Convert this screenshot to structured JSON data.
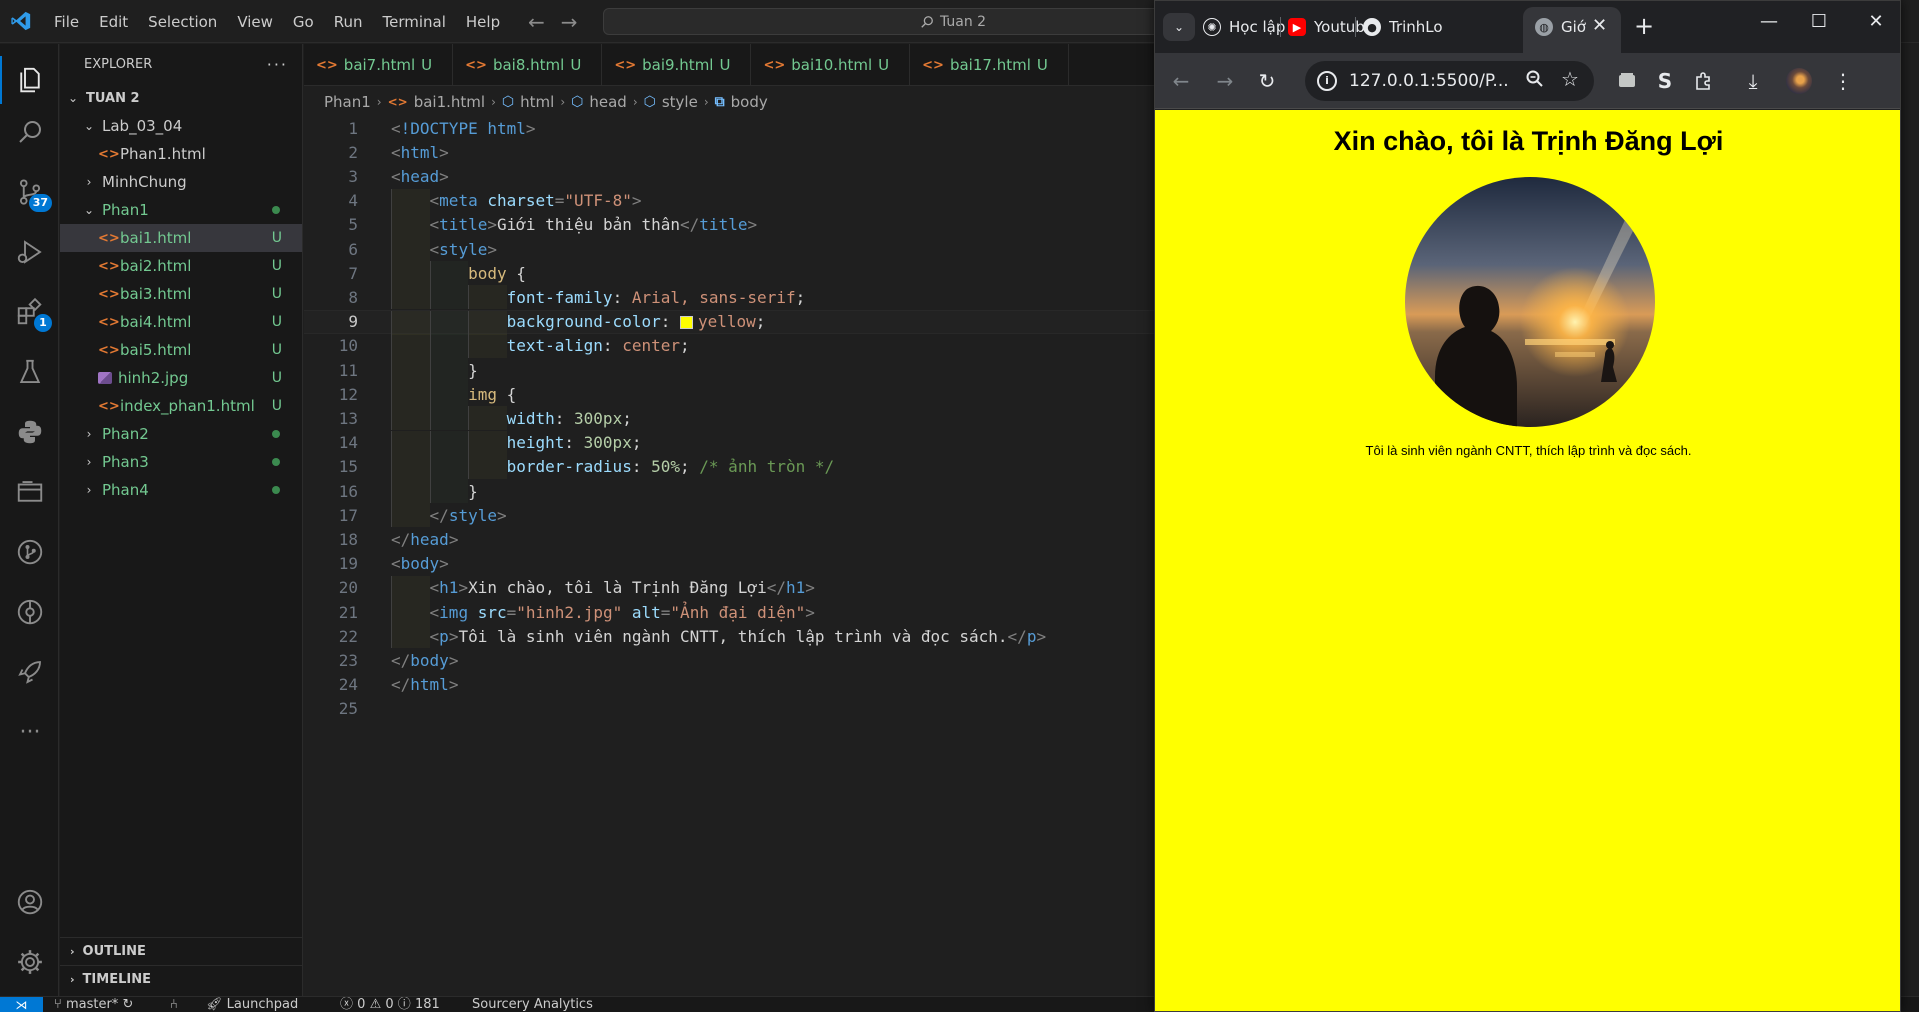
{
  "vscode": {
    "menu": [
      "File",
      "Edit",
      "Selection",
      "View",
      "Go",
      "Run",
      "Terminal",
      "Help"
    ],
    "command_center": "Tuan 2",
    "activity_badges": {
      "source_control": "37",
      "extensions": "1"
    },
    "explorer": {
      "title": "EXPLORER",
      "root": "TUAN 2",
      "items": [
        {
          "label": "Lab_03_04",
          "type": "folder-open",
          "indent": 1
        },
        {
          "label": "Phan1.html",
          "type": "html",
          "indent": 2
        },
        {
          "label": "MinhChung",
          "type": "folder",
          "indent": 1
        },
        {
          "label": "Phan1",
          "type": "folder-open",
          "indent": 1,
          "git": "dot"
        },
        {
          "label": "bai1.html",
          "type": "html",
          "indent": 2,
          "git": "U",
          "selected": true
        },
        {
          "label": "bai2.html",
          "type": "html",
          "indent": 2,
          "git": "U"
        },
        {
          "label": "bai3.html",
          "type": "html",
          "indent": 2,
          "git": "U"
        },
        {
          "label": "bai4.html",
          "type": "html",
          "indent": 2,
          "git": "U"
        },
        {
          "label": "bai5.html",
          "type": "html",
          "indent": 2,
          "git": "U"
        },
        {
          "label": "hinh2.jpg",
          "type": "image",
          "indent": 2,
          "git": "U"
        },
        {
          "label": "index_phan1.html",
          "type": "html",
          "indent": 2,
          "git": "U"
        },
        {
          "label": "Phan2",
          "type": "folder",
          "indent": 1,
          "git": "dot"
        },
        {
          "label": "Phan3",
          "type": "folder",
          "indent": 1,
          "git": "dot"
        },
        {
          "label": "Phan4",
          "type": "folder",
          "indent": 1,
          "git": "dot"
        }
      ],
      "outline": "OUTLINE",
      "timeline": "TIMELINE"
    },
    "tabs": [
      {
        "label": "bai7.html",
        "status": "U"
      },
      {
        "label": "bai8.html",
        "status": "U"
      },
      {
        "label": "bai9.html",
        "status": "U"
      },
      {
        "label": "bai10.html",
        "status": "U"
      },
      {
        "label": "bai17.html",
        "status": "U"
      }
    ],
    "breadcrumb": [
      "Phan1",
      "bai1.html",
      "html",
      "head",
      "style",
      "body"
    ],
    "current_line": 9,
    "code_lines": [
      "<!DOCTYPE html>",
      "<html>",
      "<head>",
      "    <meta charset=\"UTF-8\">",
      "    <title>Giới thiệu bản thân</title>",
      "    <style>",
      "        body {",
      "            font-family: Arial, sans-serif;",
      "            background-color: yellow;",
      "            text-align: center;",
      "        }",
      "        img {",
      "            width: 300px;",
      "            height: 300px;",
      "            border-radius: 50%; /* ảnh tròn */",
      "        }",
      "    </style>",
      "</head>",
      "<body>",
      "    <h1>Xin chào, tôi là Trịnh Đăng Lợi</h1>",
      "    <img src=\"hinh2.jpg\" alt=\"Ảnh đại diện\">",
      "    <p>Tôi là sinh viên ngành CNTT, thích lập trình và đọc sách.</p>",
      "</body>",
      "</html>",
      ""
    ],
    "status": {
      "branch": "master*",
      "launchpad": "Launchpad",
      "errors": "0",
      "warnings": "0",
      "info": "181",
      "analytics": "Sourcery Analytics"
    }
  },
  "browser": {
    "tabs": [
      {
        "label": "Học lập",
        "favicon": "chatgpt-icon"
      },
      {
        "label": "Youtub",
        "favicon": "youtube-icon"
      },
      {
        "label": "TrinhLo",
        "favicon": "github-icon"
      },
      {
        "label": "Giớ",
        "favicon": "globe-icon",
        "active": true
      }
    ],
    "url": "127.0.0.1:5500/P...",
    "page": {
      "heading": "Xin chào, tôi là Trịnh Đăng Lợi",
      "image_alt": "Ảnh đại diện",
      "paragraph": "Tôi là sinh viên ngành CNTT, thích lập trình và đọc sách.",
      "background": "#ffff00"
    }
  },
  "colors": {
    "accent": "#0078d4",
    "git_untracked": "#73c991",
    "page_background": "#ffff00"
  }
}
